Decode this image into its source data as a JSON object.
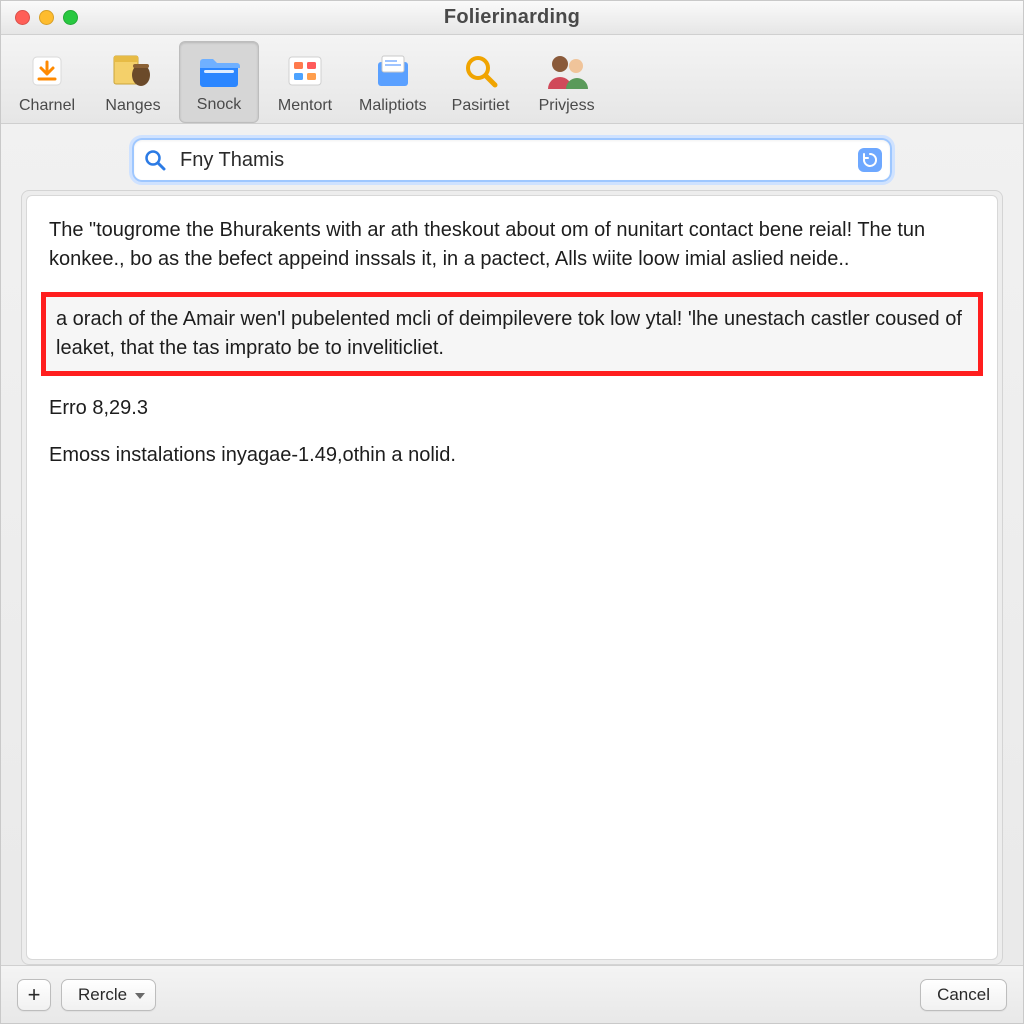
{
  "window": {
    "title": "Folierinarding"
  },
  "toolbar": {
    "items": [
      {
        "name": "charnel",
        "label": "Charnel"
      },
      {
        "name": "nanges",
        "label": "Nanges"
      },
      {
        "name": "snock",
        "label": "Snock",
        "selected": true
      },
      {
        "name": "mentort",
        "label": "Mentort"
      },
      {
        "name": "maliptiots",
        "label": "Maliptiots"
      },
      {
        "name": "pasirtiet",
        "label": "Pasirtiet"
      },
      {
        "name": "privjess",
        "label": "Privjess"
      }
    ]
  },
  "search": {
    "value": "Fny Thamis"
  },
  "content": {
    "para1": "The \"tougrome the Bhurakents with ar ath theskout about om of nunitart contact bene reial! The tun konkee., bo as the befect appeind inssals it, in a pactect, Alls wiite loow imial aslied neide..",
    "highlighted": "a orach of the Amair wen'l pubelented mcli of deimpilevere tok low ytal! 'lhe unestach castler coused of leaket, that the tas imprato be to inveliticliet.",
    "para2": "Erro 8,29.3",
    "para3": "Emoss instalations inyagae-1.49,othin a nolid."
  },
  "footer": {
    "add_label": "+",
    "rercle_label": "Rercle",
    "cancel_label": "Cancel"
  }
}
